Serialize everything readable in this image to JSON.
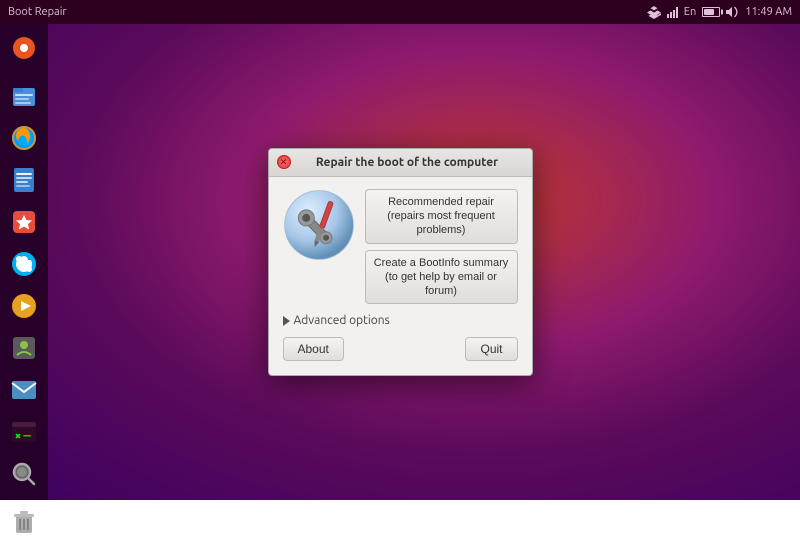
{
  "titlebar": {
    "app_title": "Boot Repair",
    "clock": "11:49 AM",
    "tray": {
      "dropbox": "☁",
      "network_label": "En",
      "volume_label": "🔊"
    }
  },
  "launcher": {
    "items": [
      {
        "name": "ubuntu-home",
        "label": "Ubuntu Home"
      },
      {
        "name": "files",
        "label": "Files"
      },
      {
        "name": "firefox",
        "label": "Firefox"
      },
      {
        "name": "libreoffice-writer",
        "label": "LibreOffice Writer"
      },
      {
        "name": "software-center",
        "label": "Ubuntu Software Center"
      },
      {
        "name": "skype",
        "label": "Skype"
      },
      {
        "name": "rhythmbox",
        "label": "Rhythmbox"
      },
      {
        "name": "plugin",
        "label": "Plugin"
      },
      {
        "name": "email",
        "label": "Thunderbird Email"
      },
      {
        "name": "terminal",
        "label": "Terminal"
      },
      {
        "name": "system-search",
        "label": "System Search"
      },
      {
        "name": "trash",
        "label": "Trash"
      }
    ]
  },
  "dialog": {
    "title": "Repair the boot of the computer",
    "recommended_repair_btn": "Recommended repair\n(repairs most frequent problems)",
    "recommended_repair_line1": "Recommended repair",
    "recommended_repair_line2": "(repairs most frequent problems)",
    "bootinfo_btn": "Create a BootInfo summary",
    "bootinfo_line1": "Create a BootInfo summary",
    "bootinfo_line2": "(to get help by email or forum)",
    "advanced_options_label": "Advanced options",
    "about_btn": "About",
    "quit_btn": "Quit"
  }
}
